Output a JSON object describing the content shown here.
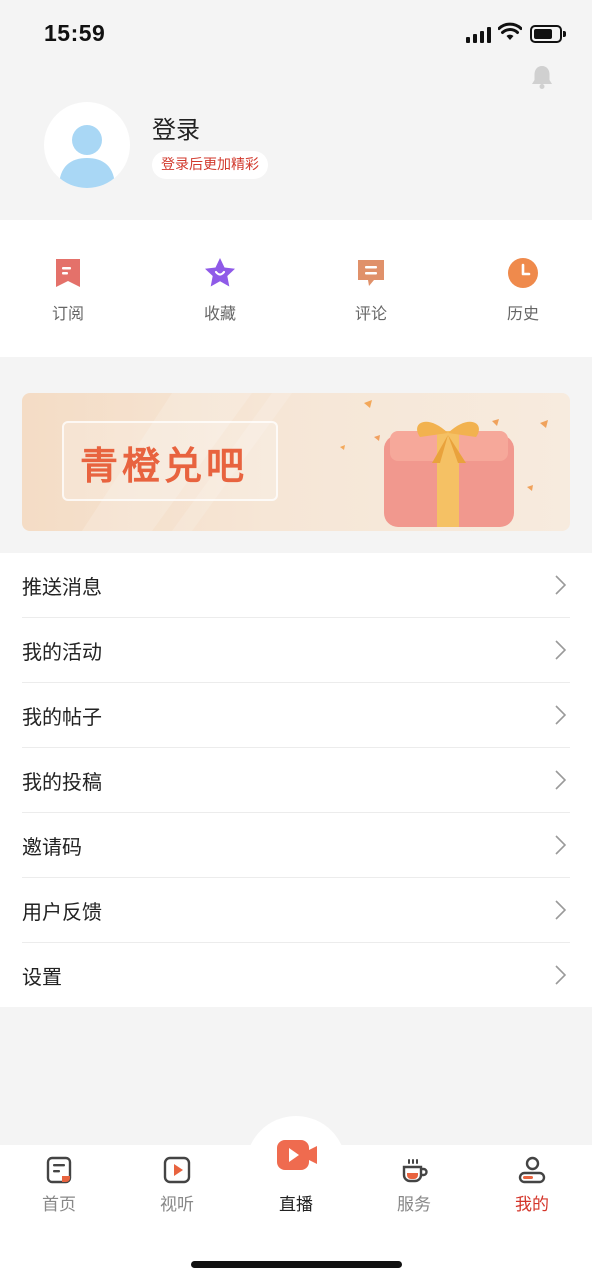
{
  "status": {
    "time": "15:59"
  },
  "profile": {
    "name": "登录",
    "tag": "登录后更加精彩"
  },
  "quick_actions": [
    {
      "label": "订阅",
      "icon": "subscribe-icon"
    },
    {
      "label": "收藏",
      "icon": "star-icon"
    },
    {
      "label": "评论",
      "icon": "comment-icon"
    },
    {
      "label": "历史",
      "icon": "clock-icon"
    }
  ],
  "banner": {
    "title": "青橙兑吧"
  },
  "menu": [
    {
      "label": "推送消息"
    },
    {
      "label": "我的活动"
    },
    {
      "label": "我的帖子"
    },
    {
      "label": "我的投稿"
    },
    {
      "label": "邀请码"
    },
    {
      "label": "用户反馈"
    },
    {
      "label": "设置"
    }
  ],
  "nav": [
    {
      "label": "首页",
      "icon": "home-icon"
    },
    {
      "label": "视听",
      "icon": "video-icon"
    },
    {
      "label": "直播",
      "icon": "live-icon"
    },
    {
      "label": "服务",
      "icon": "coffee-icon"
    },
    {
      "label": "我的",
      "icon": "user-icon"
    }
  ],
  "colors": {
    "accent": "#d4352a",
    "brand_orange": "#e8633f",
    "background": "#f4f4f4"
  }
}
